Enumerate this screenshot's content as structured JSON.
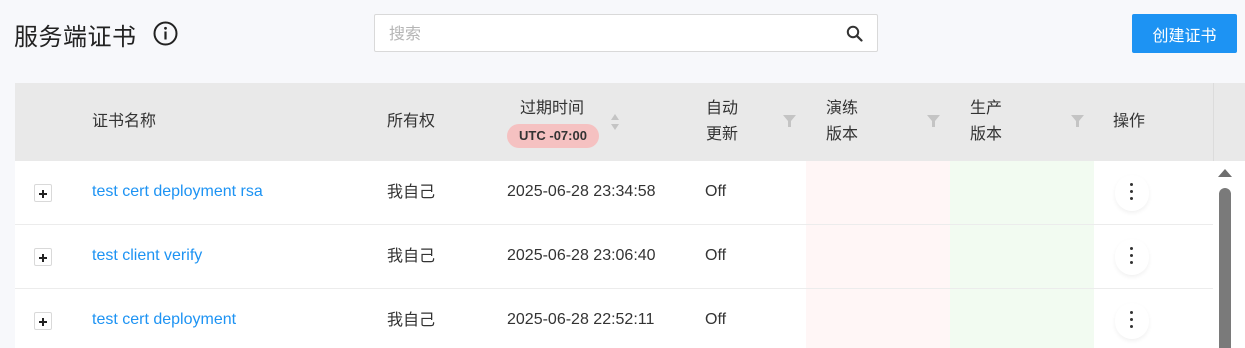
{
  "header": {
    "title": "服务端证书",
    "info_icon": "info-circle-icon",
    "search_placeholder": "搜索",
    "search_value": "",
    "create_button": "创建证书"
  },
  "table": {
    "columns": {
      "name": "证书名称",
      "owner": "所有权",
      "expiry": "过期时间",
      "timezone": "UTC -07:00",
      "auto_renew_line1": "自动",
      "auto_renew_line2": "更新",
      "rehearsal_line1": "演练",
      "rehearsal_line2": "版本",
      "prod_line1": "生产",
      "prod_line2": "版本",
      "actions": "操作"
    },
    "rows": [
      {
        "name": "test cert deployment rsa",
        "owner": "我自己",
        "expiry": "2025-06-28 23:34:58",
        "auto_renew": "Off"
      },
      {
        "name": "test client verify",
        "owner": "我自己",
        "expiry": "2025-06-28 23:06:40",
        "auto_renew": "Off"
      },
      {
        "name": "test cert deployment",
        "owner": "我自己",
        "expiry": "2025-06-28 22:52:11",
        "auto_renew": "Off"
      }
    ]
  },
  "colors": {
    "accent": "#1d93f3",
    "timezone_badge": "#f5c1c1",
    "rehearsal_bg": "#fff6f6",
    "prod_bg": "#f2fbf1"
  }
}
